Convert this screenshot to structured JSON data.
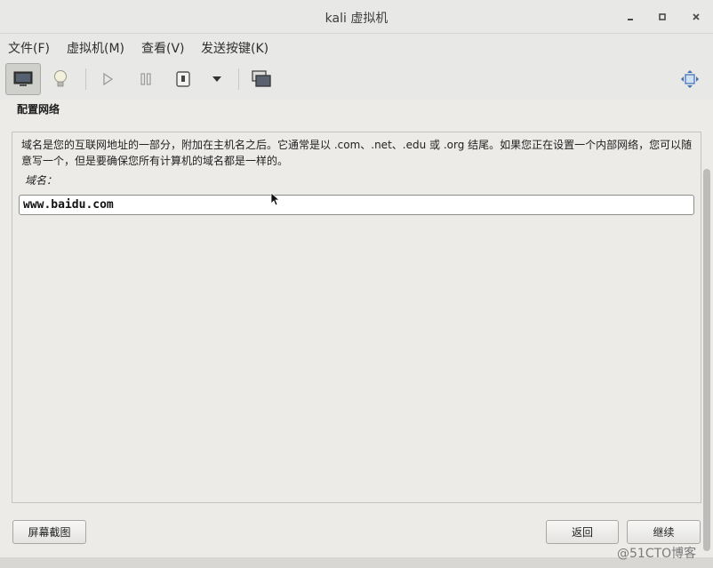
{
  "window": {
    "title": "kali 虚拟机",
    "minimize_icon": "minimize-icon",
    "maximize_icon": "maximize-icon",
    "close_icon": "close-icon"
  },
  "menu": {
    "items": [
      {
        "label": "文件(F)"
      },
      {
        "label": "虚拟机(M)"
      },
      {
        "label": "查看(V)"
      },
      {
        "label": "发送按键(K)"
      }
    ]
  },
  "toolbar": {
    "icons": [
      "monitor-icon",
      "lightbulb-icon",
      "play-icon",
      "pause-icon",
      "stop-icon",
      "dropdown-arrow-icon",
      "snapshot-icon",
      "fullscreen-icon"
    ]
  },
  "page": {
    "section_title": "配置网络",
    "description": "域名是您的互联网地址的一部分，附加在主机名之后。它通常是以 .com、.net、.edu 或 .org 结尾。如果您正在设置一个内部网络，您可以随意写一个，但是要确保您所有计算机的域名都是一样的。",
    "field_label": "域名：",
    "domain_value": "www.baidu.com"
  },
  "buttons": {
    "screenshot": "屏幕截图",
    "back": "返回",
    "continue": "继续"
  },
  "watermark": "@51CTO博客"
}
